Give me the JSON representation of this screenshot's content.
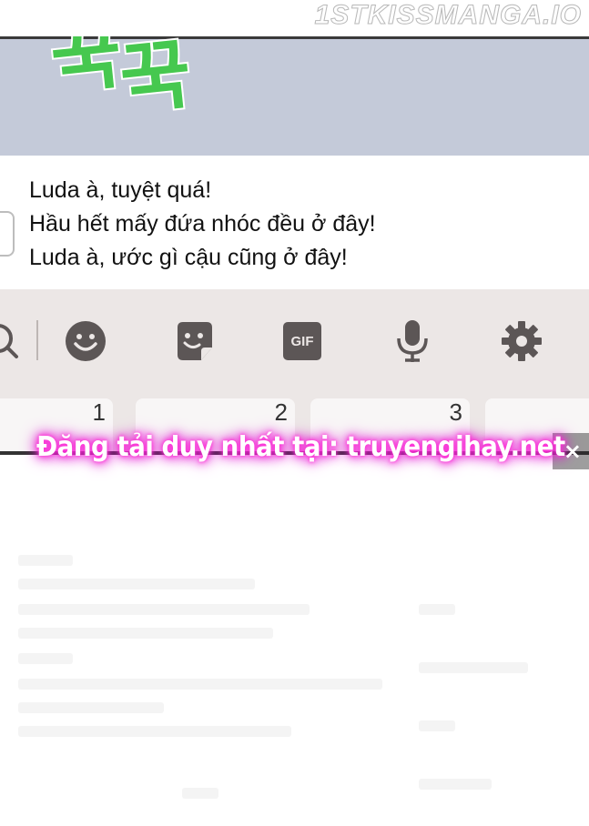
{
  "watermark": "1STKISSMANGA.IO",
  "sfx_text": [
    "꾹",
    "꾹"
  ],
  "message": {
    "lines": [
      "Luda à, tuyệt quá!",
      "Hầu hết mấy đứa nhóc đều ở đây!",
      "Luda à, ước gì cậu cũng ở đây!"
    ]
  },
  "toolbar": {
    "icons": [
      "search-icon",
      "emoji-icon",
      "sticker-icon",
      "gif-icon",
      "microphone-icon",
      "settings-icon"
    ],
    "gif_label": "GIF"
  },
  "keys": [
    "1",
    "2",
    "3"
  ],
  "banner": {
    "text": "Đăng tải duy nhất tại: truyengihay.net",
    "close": "×"
  },
  "colors": {
    "sfx_bg": "#c4cad9",
    "sfx_text": "#46c84f",
    "toolbar_bg": "#ece7e6",
    "icon": "#5c5656",
    "banner_glow": "#ff30d6"
  }
}
